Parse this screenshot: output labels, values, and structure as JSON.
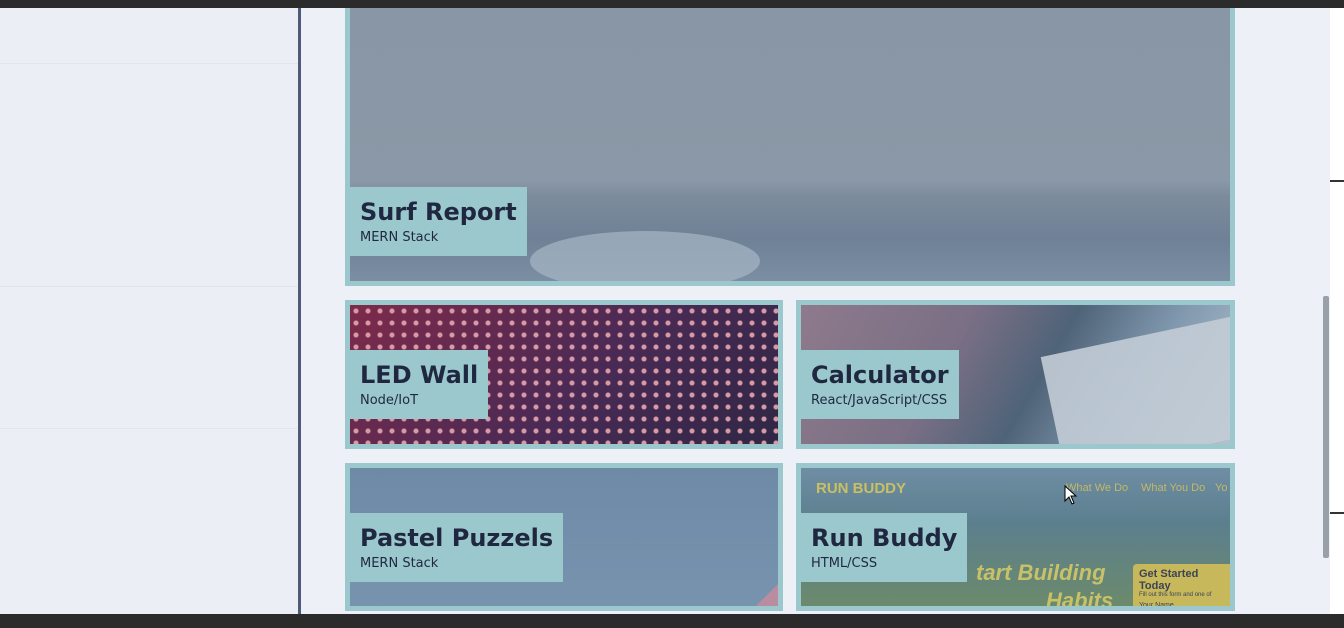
{
  "projects": [
    {
      "title": "Surf Report",
      "tech": "MERN Stack"
    },
    {
      "title": "LED Wall",
      "tech": "Node/IoT"
    },
    {
      "title": "Calculator",
      "tech": "React/JavaScript/CSS"
    },
    {
      "title": "Pastel Puzzels",
      "tech": "MERN Stack"
    },
    {
      "title": "Run Buddy",
      "tech": "HTML/CSS"
    }
  ],
  "run_buddy_preview": {
    "logo": "RUN BUDDY",
    "nav": [
      "What We Do",
      "What You Do",
      "Yo"
    ],
    "hero_line1": "tart Building",
    "hero_line2": "Habits",
    "cta_title": "Get Started Today",
    "cta_text": "Fill out this form and one of",
    "cta_field": "Your Name"
  },
  "colors": {
    "accent": "#9bc8cc",
    "label_text": "#1f2840",
    "divider": "#4e5a78",
    "background": "#eef0f8"
  }
}
